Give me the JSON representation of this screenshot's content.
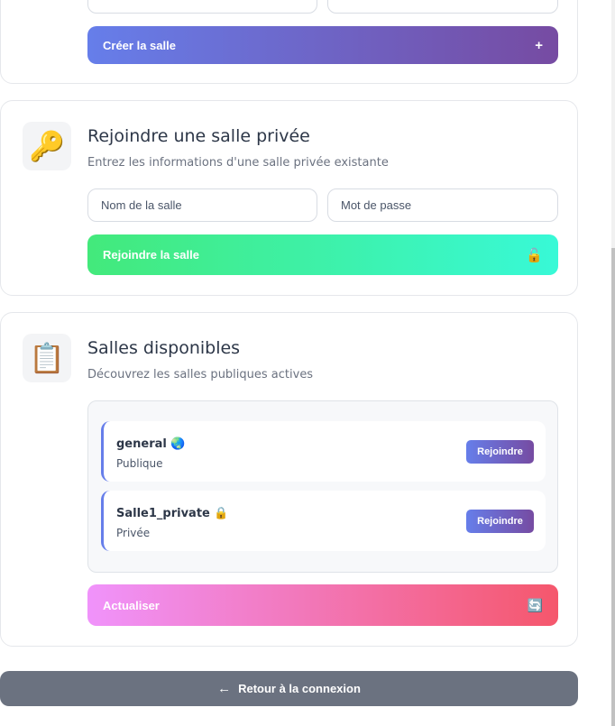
{
  "create_section": {
    "create_button_label": "Créer la salle",
    "create_button_icon": "+"
  },
  "join_section": {
    "icon": "🔑",
    "title": "Rejoindre une salle privée",
    "subtitle": "Entrez les informations d'une salle privée existante",
    "room_name_placeholder": "Nom de la salle",
    "password_placeholder": "Mot de passe",
    "join_button_label": "Rejoindre la salle",
    "join_button_icon": "🔓"
  },
  "available_section": {
    "icon": "📋",
    "title": "Salles disponibles",
    "subtitle": "Découvrez les salles publiques actives",
    "rooms": [
      {
        "name": "general",
        "badge": "🌏",
        "type": "Publique",
        "join_label": "Rejoindre"
      },
      {
        "name": "Salle1_private",
        "badge": "🔒",
        "type": "Privée",
        "join_label": "Rejoindre"
      }
    ],
    "refresh_label": "Actualiser",
    "refresh_icon": "🔄"
  },
  "back_button": {
    "arrow": "←",
    "label": "Retour à la connexion"
  },
  "colors": {
    "create_gradient": [
      "#667eea",
      "#764ba2"
    ],
    "join_gradient": [
      "#43e97b",
      "#38f9d7"
    ],
    "refresh_gradient": [
      "#f093fb",
      "#f5576c"
    ],
    "back": "#6b7280"
  }
}
